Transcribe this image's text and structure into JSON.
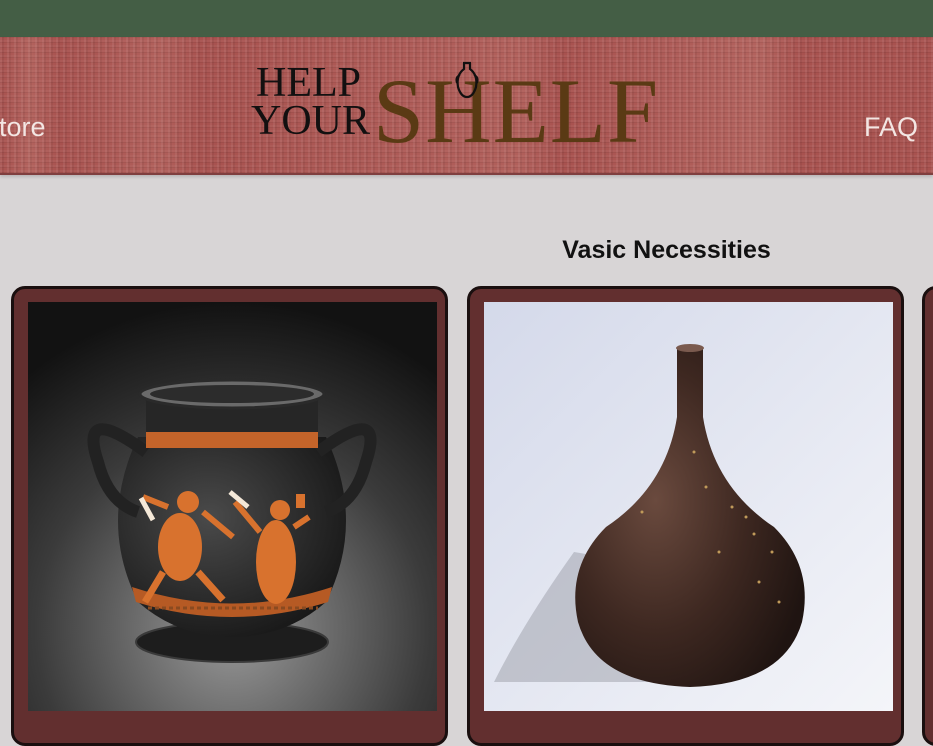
{
  "header": {
    "nav_left_label": "tore",
    "nav_right_label": "FAQ",
    "logo": {
      "line1": "HELP",
      "line2": "YOUR",
      "big": "SHELF"
    }
  },
  "main": {
    "section_title": "Vasic Necessities"
  },
  "products": [
    {
      "image": "greek-pyxis-black-figure-vase"
    },
    {
      "image": "brown-bottle-vase"
    },
    {
      "image": "partial-third-item"
    }
  ],
  "colors": {
    "top_bar": "#445e45",
    "header_bg": "#a8524f",
    "page_bg": "#d8d5d6",
    "card_bg": "#622f2f",
    "nav_text": "#f3e6e3",
    "logo_brown": "#5a3a14"
  }
}
